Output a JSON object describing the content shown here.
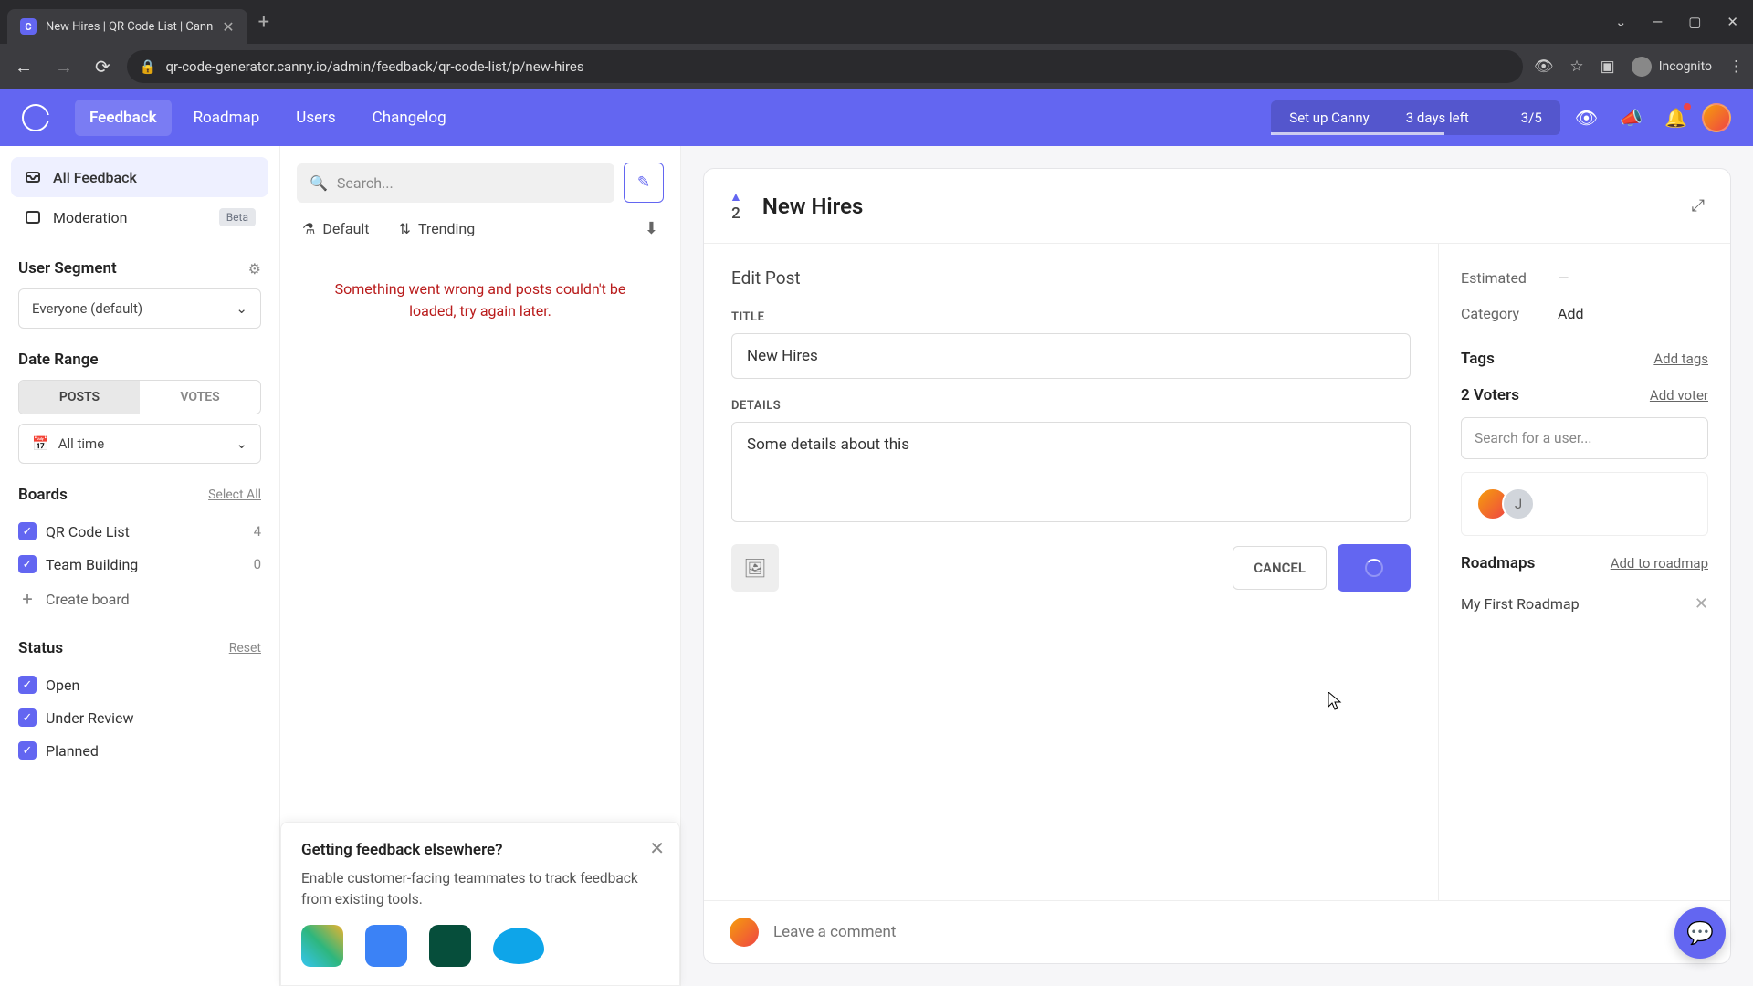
{
  "browser": {
    "tab_title": "New Hires | QR Code List | Cann",
    "url": "qr-code-generator.canny.io/admin/feedback/qr-code-list/p/new-hires",
    "incognito_label": "Incognito"
  },
  "header": {
    "nav": [
      "Feedback",
      "Roadmap",
      "Users",
      "Changelog"
    ],
    "setup_label": "Set up Canny",
    "trial_label": "3 days left",
    "progress": "3/5"
  },
  "sidebar": {
    "all_feedback": "All Feedback",
    "moderation": "Moderation",
    "beta": "Beta",
    "user_segment": "User Segment",
    "segment_value": "Everyone (default)",
    "date_range": "Date Range",
    "posts_tab": "POSTS",
    "votes_tab": "VOTES",
    "time_value": "All time",
    "boards": "Boards",
    "select_all": "Select All",
    "board_items": [
      {
        "name": "QR Code List",
        "count": "4"
      },
      {
        "name": "Team Building",
        "count": "0"
      }
    ],
    "create_board": "Create board",
    "status": "Status",
    "reset": "Reset",
    "status_items": [
      "Open",
      "Under Review",
      "Planned"
    ]
  },
  "posts": {
    "search_placeholder": "Search...",
    "default": "Default",
    "trending": "Trending",
    "error": "Something went wrong and posts couldn't be loaded, try again later.",
    "feedback_title": "Getting feedback elsewhere?",
    "feedback_text": "Enable customer-facing teammates to track feedback from existing tools."
  },
  "detail": {
    "vote_count": "2",
    "title": "New Hires",
    "edit_heading": "Edit Post",
    "title_label": "TITLE",
    "title_value": "New Hires",
    "details_label": "DETAILS",
    "details_value": "Some details about this",
    "cancel": "CANCEL",
    "estimated_label": "Estimated",
    "estimated_value": "—",
    "category_label": "Category",
    "category_action": "Add",
    "tags": "Tags",
    "add_tags": "Add tags",
    "voters_title": "2 Voters",
    "add_voter": "Add voter",
    "voter_search": "Search for a user...",
    "roadmaps": "Roadmaps",
    "add_roadmap": "Add to roadmap",
    "roadmap_item": "My First Roadmap",
    "comment_placeholder": "Leave a comment"
  }
}
